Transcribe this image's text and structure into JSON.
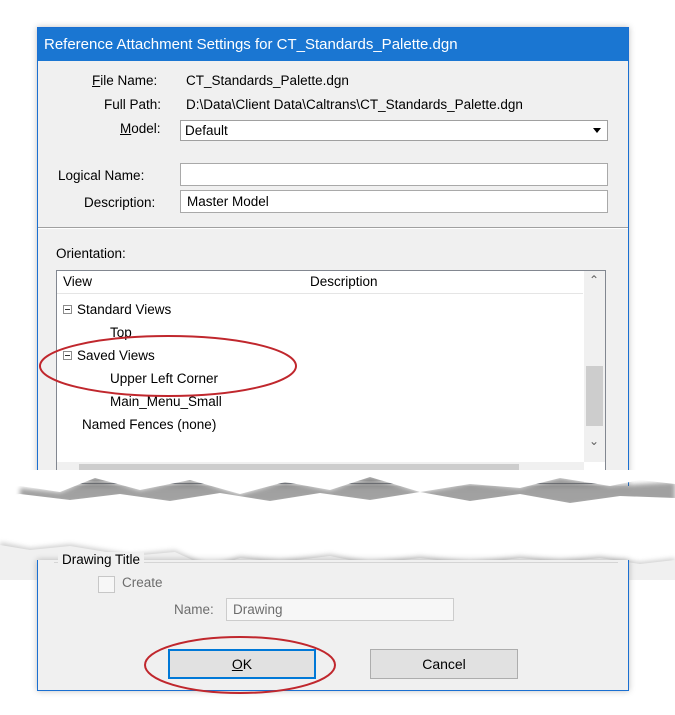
{
  "window": {
    "title": "Reference Attachment Settings for CT_Standards_Palette.dgn"
  },
  "fields": {
    "file_name_label": "File Name:",
    "file_name_value": "CT_Standards_Palette.dgn",
    "full_path_label": "Full Path:",
    "full_path_value": "D:\\Data\\Client Data\\Caltrans\\CT_Standards_Palette.dgn",
    "model_label": "Model:",
    "model_value": "Default",
    "logical_name_label": "Logical Name:",
    "logical_name_value": "",
    "description_label": "Description:",
    "description_value": "Master Model"
  },
  "orientation": {
    "label": "Orientation:",
    "columns": [
      "View",
      "Description"
    ],
    "rows": [
      {
        "label": "Standard Views"
      },
      {
        "label": "Top"
      },
      {
        "label": "Saved Views"
      },
      {
        "label": "Upper Left Corner"
      },
      {
        "label": "Main_Menu_Small"
      },
      {
        "label": "Named Fences (none)"
      }
    ]
  },
  "drawing_title": {
    "group_label": "Drawing Title",
    "create_label": "Create",
    "create_checked": false,
    "name_label": "Name:",
    "name_value": "Drawing"
  },
  "buttons": {
    "ok": "OK",
    "cancel": "Cancel"
  },
  "colors": {
    "titlebar": "#1a76d2",
    "highlight_ring": "#c0272d",
    "default_button_border": "#0078d7"
  }
}
